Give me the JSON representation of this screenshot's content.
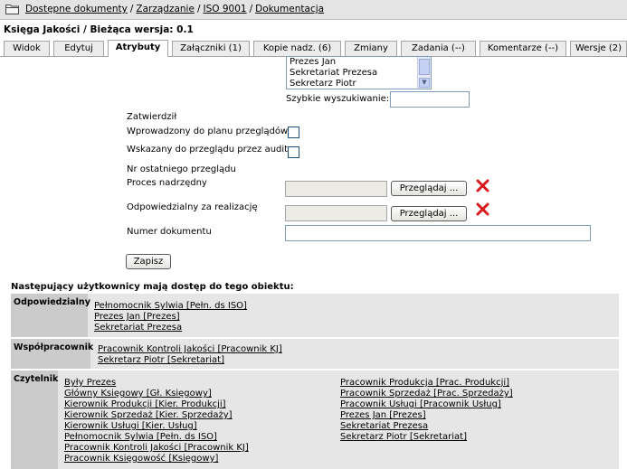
{
  "breadcrumb": {
    "items": [
      "Dostępne dokumenty",
      "Zarządzanie",
      "ISO 9001",
      "Dokumentacja"
    ],
    "separator": "/"
  },
  "document": {
    "title_prefix": "Księga Jakości / Bieżąca wersja:",
    "version": "0.1"
  },
  "tabs": [
    {
      "label": "Widok",
      "active": false
    },
    {
      "label": "Edytuj",
      "active": false
    },
    {
      "label": "Atrybuty",
      "active": true
    },
    {
      "label": "Załączniki (1)",
      "active": false
    },
    {
      "label": "Kopie nadz. (6)",
      "active": false
    },
    {
      "label": "Zmiany",
      "active": false
    },
    {
      "label": "Zadania (--)",
      "active": false
    },
    {
      "label": "Komentarze (--)",
      "active": false
    },
    {
      "label": "Wersje (2)",
      "active": false
    }
  ],
  "form": {
    "user_list_options": [
      "Prezes Jan",
      "Sekretariat Prezesa",
      "Sekretarz Piotr"
    ],
    "quick_search_label": "Szybkie wyszukiwanie:",
    "quick_search_value": "",
    "approved_label": "Zatwierdził",
    "review_plan_label": "Wprowadzony do planu przeglądów",
    "review_plan_checked": false,
    "audit_label": "Wskazany do przeglądu przez audit",
    "audit_checked": false,
    "last_review_label": "Nr ostatniego przeglądu",
    "parent_process_label": "Proces nadrzędny",
    "parent_process_value": "",
    "responsible_label": "Odpowiedzialny za realizację",
    "responsible_value": "",
    "doc_number_label": "Numer dokumentu",
    "doc_number_value": "",
    "browse_label": "Przeglądaj ...",
    "save_label": "Zapisz"
  },
  "access": {
    "heading": "Następujący użytkownicy mają dostęp do tego obiektu:",
    "groups": {
      "responsible": {
        "label": "Odpowiedzialny",
        "members": [
          "Pełnomocnik Sylwia [Pełn. ds ISO]",
          "Prezes Jan [Prezes]",
          "Sekretariat Prezesa"
        ]
      },
      "collaborators": {
        "label": "Współpracownik",
        "members": [
          "Pracownik Kontroli Jakości [Pracownik KJ]",
          "Sekretarz Piotr [Sekretariat]"
        ]
      },
      "readers": {
        "label": "Czytelnik",
        "members_col1": [
          "Były Prezes",
          "Główny Księgowy [Gł. Księgowy]",
          "Kierownik Produkcji [Kier. Produkcji]",
          "Kierownik Sprzedaż [Kier. Sprzedaży]",
          "Kierownik Usługi [Kier. Usług]",
          "Pełnomocnik Sylwia [Pełn. ds ISO]",
          "Pracownik Kontroli Jakości [Pracownik KJ]",
          "Pracownik Księgowość [Księgowy]"
        ],
        "members_col2": [
          "Pracownik Produkcja [Prac. Produkcji]",
          "Pracownik Sprzedaż [Prac. Sprzedaży]",
          "Pracownik Usługi [Pracownik Usług]",
          "Prezes Jan [Prezes]",
          "Sekretariat Prezesa",
          "Sekretarz Piotr [Sekretariat]"
        ]
      }
    }
  }
}
